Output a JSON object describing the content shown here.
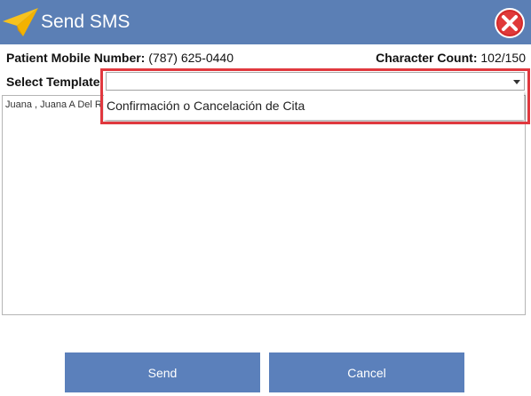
{
  "window": {
    "title": "Send SMS",
    "title_icon": "paper-plane-icon",
    "close_icon": "close-x-icon",
    "accent_color": "#5b7fb5",
    "close_color": "#d42a2a"
  },
  "info": {
    "mobile_label": "Patient Mobile Number:",
    "mobile_value": "(787) 625-0440",
    "count_label": "Character Count:",
    "count_value": "102/150"
  },
  "template": {
    "label": "Select Template:",
    "selected": "",
    "options": [
      "Confirmación o Cancelación de Cita"
    ]
  },
  "message": {
    "text": "Juana , Juana A Del R"
  },
  "buttons": {
    "send": "Send",
    "cancel": "Cancel"
  },
  "highlight_color": "#e0383e"
}
